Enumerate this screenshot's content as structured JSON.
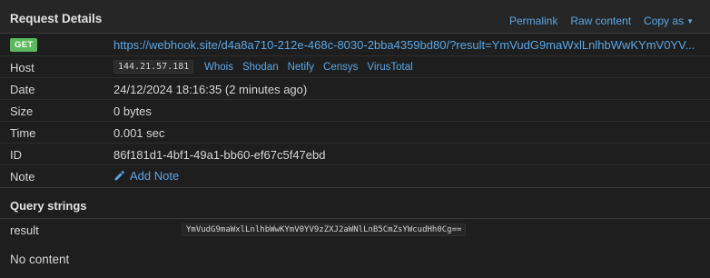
{
  "header": {
    "title": "Request Details",
    "links": {
      "permalink": "Permalink",
      "raw_content": "Raw content",
      "copy_as": "Copy as"
    }
  },
  "request": {
    "method": "GET",
    "url": "https://webhook.site/d4a8a710-212e-468c-8030-2bba4359bd80/?result=YmVudG9maWxlLnlhbWwKYmV0YV...",
    "host_label": "Host",
    "host_ip": "144.21.57.181",
    "host_links": [
      "Whois",
      "Shodan",
      "Netify",
      "Censys",
      "VirusTotal"
    ],
    "date_label": "Date",
    "date": "24/12/2024 18:16:35 (2 minutes ago)",
    "size_label": "Size",
    "size": "0 bytes",
    "time_label": "Time",
    "time": "0.001 sec",
    "id_label": "ID",
    "id": "86f181d1-4bf1-49a1-bb60-ef67c5f47ebd",
    "note_label": "Note",
    "add_note": "Add Note"
  },
  "query_strings": {
    "title": "Query strings",
    "items": [
      {
        "key": "result",
        "value": "YmVudG9maWxlLnlhbWwKYmV0YV9zZXJ2aWNlLnB5CmZsYWcudHh0Cg=="
      }
    ]
  },
  "body": {
    "empty_text": "No content"
  },
  "colors": {
    "link": "#5aa7e6",
    "get_badge": "#5cb85c",
    "background": "#1e1e1e"
  }
}
